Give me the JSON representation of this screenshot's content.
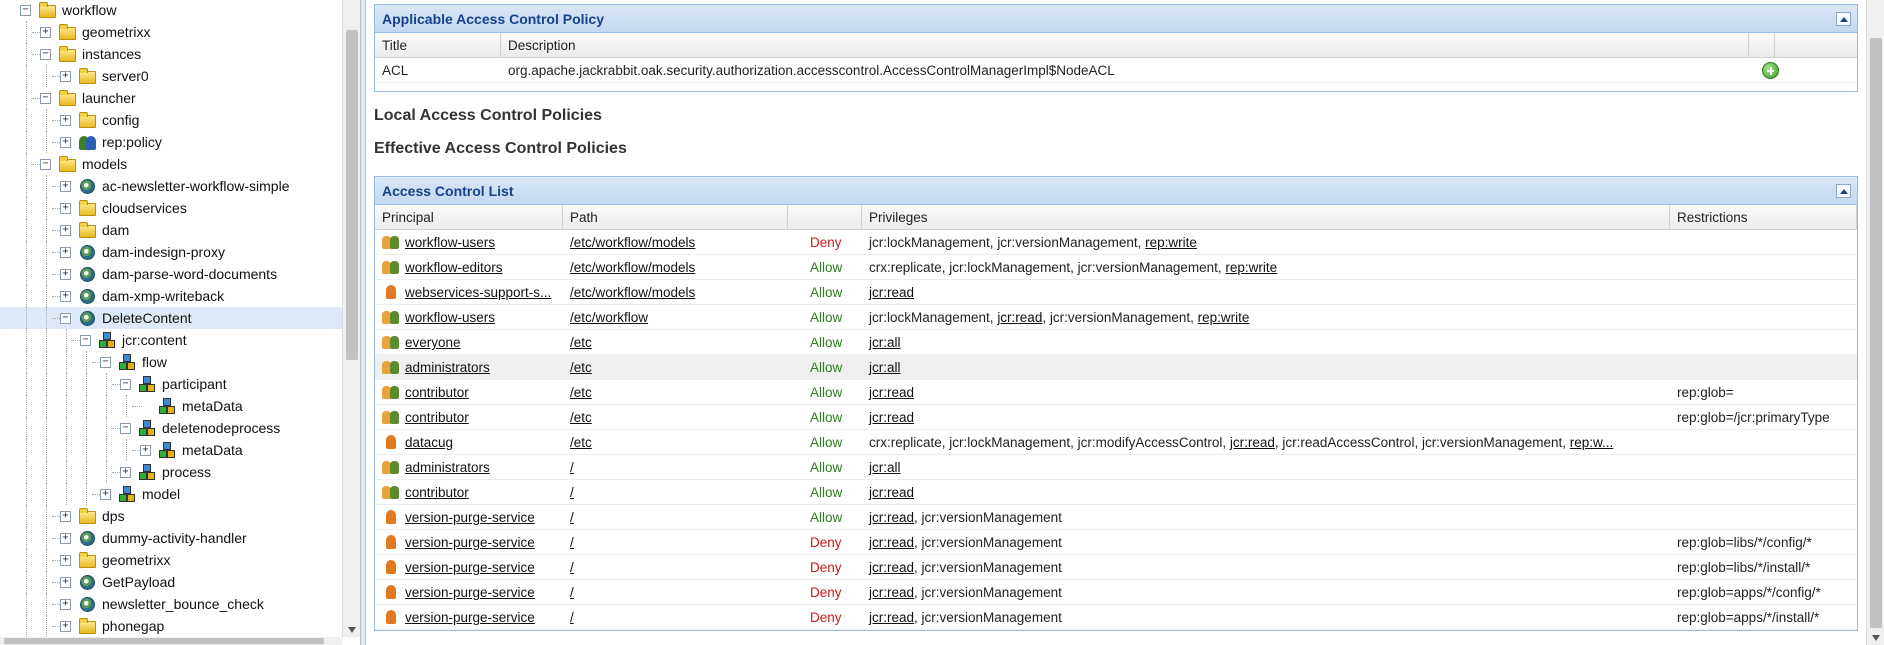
{
  "tree": {
    "nodes": [
      {
        "label": "workflow",
        "depth": 1,
        "toggle": "-",
        "icon": "folder-icon"
      },
      {
        "label": "geometrixx",
        "depth": 2,
        "toggle": "+",
        "icon": "folder-icon"
      },
      {
        "label": "instances",
        "depth": 2,
        "toggle": "-",
        "icon": "folder-icon"
      },
      {
        "label": "server0",
        "depth": 3,
        "toggle": "+",
        "icon": "folder-icon"
      },
      {
        "label": "launcher",
        "depth": 2,
        "toggle": "-",
        "icon": "folder-icon"
      },
      {
        "label": "config",
        "depth": 3,
        "toggle": "+",
        "icon": "folder-icon"
      },
      {
        "label": "rep:policy",
        "depth": 3,
        "toggle": "+",
        "icon": "policy-icon"
      },
      {
        "label": "models",
        "depth": 2,
        "toggle": "-",
        "icon": "folder-icon"
      },
      {
        "label": "ac-newsletter-workflow-simple",
        "depth": 3,
        "toggle": "+",
        "icon": "workflow-model-icon"
      },
      {
        "label": "cloudservices",
        "depth": 3,
        "toggle": "+",
        "icon": "folder-icon"
      },
      {
        "label": "dam",
        "depth": 3,
        "toggle": "+",
        "icon": "folder-icon"
      },
      {
        "label": "dam-indesign-proxy",
        "depth": 3,
        "toggle": "+",
        "icon": "workflow-model-icon"
      },
      {
        "label": "dam-parse-word-documents",
        "depth": 3,
        "toggle": "+",
        "icon": "workflow-model-icon"
      },
      {
        "label": "dam-xmp-writeback",
        "depth": 3,
        "toggle": "+",
        "icon": "workflow-model-icon"
      },
      {
        "label": "DeleteContent",
        "depth": 3,
        "toggle": "-",
        "icon": "workflow-model-icon",
        "selected": true
      },
      {
        "label": "jcr:content",
        "depth": 4,
        "toggle": "-",
        "icon": "node-icon"
      },
      {
        "label": "flow",
        "depth": 5,
        "toggle": "-",
        "icon": "node-icon"
      },
      {
        "label": "participant",
        "depth": 6,
        "toggle": "-",
        "icon": "node-icon"
      },
      {
        "label": "metaData",
        "depth": 7,
        "toggle": "",
        "icon": "node-icon"
      },
      {
        "label": "deletenodeprocess",
        "depth": 6,
        "toggle": "-",
        "icon": "node-icon"
      },
      {
        "label": "metaData",
        "depth": 7,
        "toggle": "+",
        "icon": "node-icon"
      },
      {
        "label": "process",
        "depth": 6,
        "toggle": "+",
        "icon": "node-icon"
      },
      {
        "label": "model",
        "depth": 5,
        "toggle": "+",
        "icon": "node-icon"
      },
      {
        "label": "dps",
        "depth": 3,
        "toggle": "+",
        "icon": "folder-icon"
      },
      {
        "label": "dummy-activity-handler",
        "depth": 3,
        "toggle": "+",
        "icon": "workflow-model-icon"
      },
      {
        "label": "geometrixx",
        "depth": 3,
        "toggle": "+",
        "icon": "folder-icon"
      },
      {
        "label": "GetPayload",
        "depth": 3,
        "toggle": "+",
        "icon": "workflow-model-icon"
      },
      {
        "label": "newsletter_bounce_check",
        "depth": 3,
        "toggle": "+",
        "icon": "workflow-model-icon"
      },
      {
        "label": "phonegap",
        "depth": 3,
        "toggle": "+",
        "icon": "folder-icon"
      }
    ]
  },
  "applicable_policy": {
    "title": "Applicable Access Control Policy",
    "columns": [
      "Title",
      "Description"
    ],
    "rows": [
      {
        "title": "ACL",
        "description": "org.apache.jackrabbit.oak.security.authorization.accesscontrol.AccessControlManagerImpl$NodeACL"
      }
    ]
  },
  "local_policies_title": "Local Access Control Policies",
  "effective_policies_title": "Effective Access Control Policies",
  "acl": {
    "title": "Access Control List",
    "columns": [
      "Principal",
      "Path",
      "",
      "Privileges",
      "Restrictions"
    ],
    "rows": [
      {
        "principal": "workflow-users",
        "ptype": "group",
        "path": "/etc/workflow/models",
        "access": "Deny",
        "privileges": [
          {
            "t": "jcr:lockManagement, "
          },
          {
            "t": "jcr:versionManagement, "
          },
          {
            "t": "rep:write",
            "link": true
          }
        ],
        "restrictions": ""
      },
      {
        "principal": "workflow-editors",
        "ptype": "group",
        "path": "/etc/workflow/models",
        "access": "Allow",
        "privileges": [
          {
            "t": "crx:replicate, "
          },
          {
            "t": "jcr:lockManagement, "
          },
          {
            "t": "jcr:versionManagement, "
          },
          {
            "t": "rep:write",
            "link": true
          }
        ],
        "restrictions": ""
      },
      {
        "principal": "webservices-support-s...",
        "ptype": "user",
        "path": "/etc/workflow/models",
        "access": "Allow",
        "privileges": [
          {
            "t": "jcr:read",
            "link": true
          }
        ],
        "restrictions": ""
      },
      {
        "principal": "workflow-users",
        "ptype": "group",
        "path": "/etc/workflow",
        "access": "Allow",
        "privileges": [
          {
            "t": "jcr:lockManagement, "
          },
          {
            "t": "jcr:read",
            "link": true
          },
          {
            "t": ", jcr:versionManagement, "
          },
          {
            "t": "rep:write",
            "link": true
          }
        ],
        "restrictions": ""
      },
      {
        "principal": "everyone",
        "ptype": "group",
        "path": "/etc",
        "access": "Allow",
        "privileges": [
          {
            "t": "jcr:all",
            "link": true
          }
        ],
        "restrictions": ""
      },
      {
        "principal": "administrators",
        "ptype": "group",
        "path": "/etc",
        "access": "Allow",
        "privileges": [
          {
            "t": "jcr:all",
            "link": true
          }
        ],
        "restrictions": "",
        "alt": true
      },
      {
        "principal": "contributor",
        "ptype": "group",
        "path": "/etc",
        "access": "Allow",
        "privileges": [
          {
            "t": "jcr:read",
            "link": true
          }
        ],
        "restrictions": "rep:glob="
      },
      {
        "principal": "contributor",
        "ptype": "group",
        "path": "/etc",
        "access": "Allow",
        "privileges": [
          {
            "t": "jcr:read",
            "link": true
          }
        ],
        "restrictions": "rep:glob=/jcr:primaryType"
      },
      {
        "principal": "datacug",
        "ptype": "user",
        "path": "/etc",
        "access": "Allow",
        "privileges": [
          {
            "t": "crx:replicate, jcr:lockManagement, jcr:modifyAccessControl, "
          },
          {
            "t": "jcr:read",
            "link": true
          },
          {
            "t": ", jcr:readAccessControl, jcr:versionManagement, "
          },
          {
            "t": "rep:w...",
            "link": true
          }
        ],
        "restrictions": ""
      },
      {
        "principal": "administrators",
        "ptype": "group",
        "path": "/",
        "access": "Allow",
        "privileges": [
          {
            "t": "jcr:all",
            "link": true
          }
        ],
        "restrictions": ""
      },
      {
        "principal": "contributor",
        "ptype": "group",
        "path": "/",
        "access": "Allow",
        "privileges": [
          {
            "t": "jcr:read",
            "link": true
          }
        ],
        "restrictions": ""
      },
      {
        "principal": "version-purge-service",
        "ptype": "user",
        "path": "/",
        "access": "Allow",
        "privileges": [
          {
            "t": "jcr:read",
            "link": true
          },
          {
            "t": ", jcr:versionManagement"
          }
        ],
        "restrictions": ""
      },
      {
        "principal": "version-purge-service",
        "ptype": "user",
        "path": "/",
        "access": "Deny",
        "privileges": [
          {
            "t": "jcr:read",
            "link": true
          },
          {
            "t": ", jcr:versionManagement"
          }
        ],
        "restrictions": "rep:glob=libs/*/config/*"
      },
      {
        "principal": "version-purge-service",
        "ptype": "user",
        "path": "/",
        "access": "Deny",
        "privileges": [
          {
            "t": "jcr:read",
            "link": true
          },
          {
            "t": ", jcr:versionManagement"
          }
        ],
        "restrictions": "rep:glob=libs/*/install/*"
      },
      {
        "principal": "version-purge-service",
        "ptype": "user",
        "path": "/",
        "access": "Deny",
        "privileges": [
          {
            "t": "jcr:read",
            "link": true
          },
          {
            "t": ", jcr:versionManagement"
          }
        ],
        "restrictions": "rep:glob=apps/*/config/*"
      },
      {
        "principal": "version-purge-service",
        "ptype": "user",
        "path": "/",
        "access": "Deny",
        "privileges": [
          {
            "t": "jcr:read",
            "link": true
          },
          {
            "t": ", jcr:versionManagement"
          }
        ],
        "restrictions": "rep:glob=apps/*/install/*"
      }
    ]
  },
  "colors": {
    "deny": "#cc1a1a",
    "allow": "#2e7d1e",
    "panel_header": "#15428b"
  }
}
